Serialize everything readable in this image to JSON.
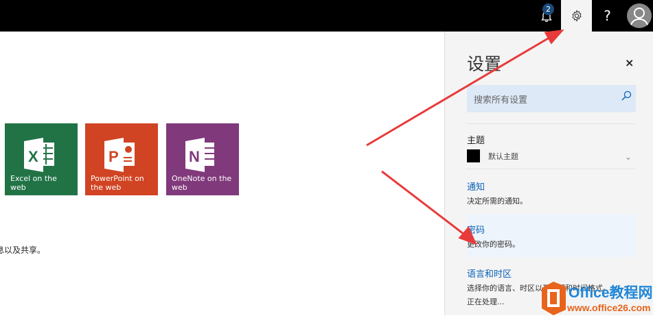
{
  "topbar": {
    "notification_count": "2",
    "help_label": "?"
  },
  "tiles": [
    {
      "label": "Excel on the web",
      "letter": "X"
    },
    {
      "label": "PowerPoint on the web",
      "letter": "P"
    },
    {
      "label": "OneNote on the web",
      "letter": "N"
    }
  ],
  "body_text": "息以及共享。",
  "settings": {
    "title": "设置",
    "close": "×",
    "search_placeholder": "搜索所有设置",
    "theme": {
      "heading": "主题",
      "value": "默认主题"
    },
    "notifications": {
      "heading": "通知",
      "desc": "决定所需的通知。"
    },
    "password": {
      "heading": "密码",
      "desc": "更改你的密码。"
    },
    "language": {
      "heading": "语言和时区",
      "desc": "选择你的语言、时区以及日期和时间格式。",
      "status": "正在处理..."
    }
  },
  "watermark": {
    "title": "Office教程网",
    "url": "www.office26.com"
  },
  "colors": {
    "excel": "#217346",
    "powerpoint": "#d04423",
    "onenote": "#80397b",
    "link": "#0a62b8",
    "arrow": "#e83a3a"
  }
}
